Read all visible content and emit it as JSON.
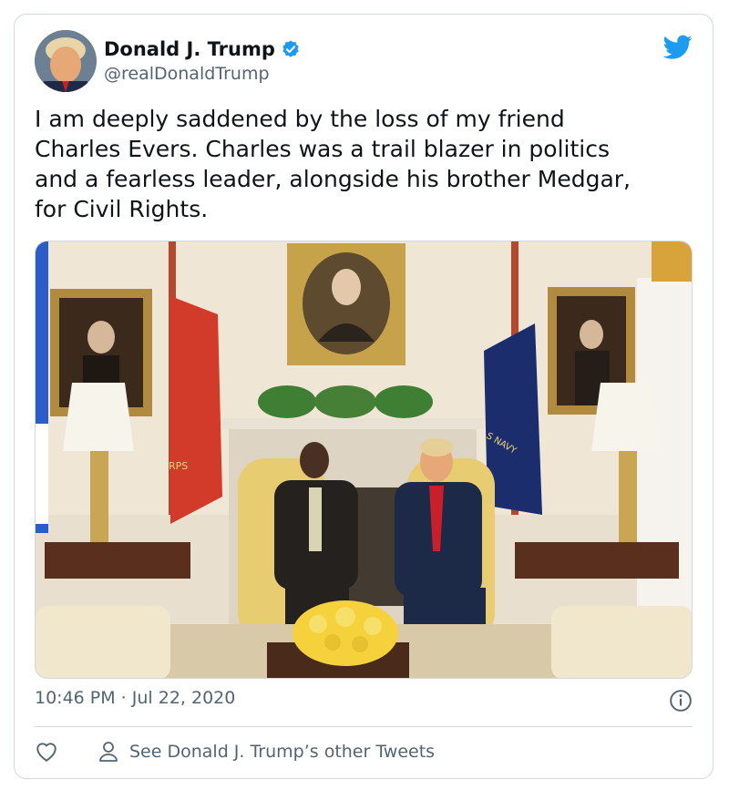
{
  "tweet": {
    "author_name": "Donald J. Trump",
    "author_handle": "@realDonaldTrump",
    "text_lines": [
      "I am deeply saddened by the loss of my friend",
      "Charles Evers. Charles was a trail blazer in politics",
      "and a fearless leader, alongside his brother Medgar,",
      "for Civil Rights."
    ],
    "timestamp": "10:46 PM · Jul 22, 2020",
    "see_other_label": "See Donald J. Trump’s other Tweets"
  },
  "icons": {
    "verified": "verified-badge-icon",
    "platform": "twitter-bird-icon",
    "info": "info-icon",
    "like": "heart-icon",
    "profile": "person-icon"
  },
  "photo": {
    "flag_left_text": "RPS",
    "flag_right_text": "S NAVY"
  },
  "colors": {
    "brand_blue": "#1d9bf0",
    "text_primary": "#0f1419",
    "text_secondary": "#536471",
    "border": "#cfd9de"
  }
}
